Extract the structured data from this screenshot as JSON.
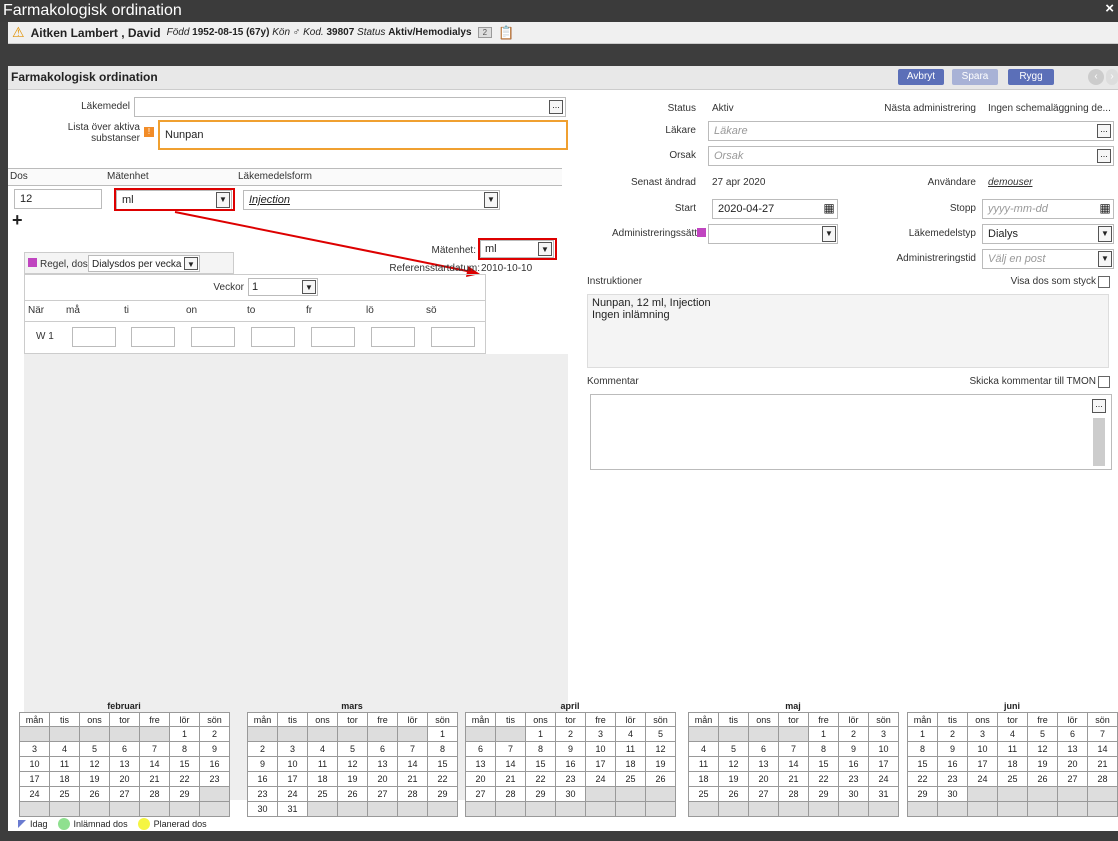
{
  "window": {
    "title": "Farmakologisk ordination",
    "close": "×"
  },
  "patient": {
    "name": "Aitken Lambert , David",
    "born_label": "Född",
    "born": "1952-08-15 (67y)",
    "sex_label": "Kön",
    "code_label": "Kod.",
    "code": "39807",
    "status_label": "Status",
    "status": "Aktiv/Hemodialys",
    "badge": "2"
  },
  "toolbar": {
    "title": "Farmakologisk ordination",
    "cancel": "Avbryt",
    "save": "Spara",
    "back": "Rygg",
    "colors": {
      "button": "#5b6fb8",
      "disabled": "#a8b2d6"
    }
  },
  "left": {
    "drug_label": "Läkemedel",
    "drug_value": "",
    "substances_label1": "Lista över aktiva",
    "substances_label2": "substanser",
    "substances_value": "Nunpan",
    "dose_header": "Dos",
    "unit_header": "Mätenhet",
    "form_header": "Läkemedelsform",
    "dose": "12",
    "unit": "ml",
    "form": "Injection",
    "add": "+",
    "rule_label": "Regel, dos",
    "rule_value": "Dialysdos per vecka",
    "unit2_label": "Mätenhet:",
    "unit2_value": "ml",
    "refdate_label": "Referensstartdatum:",
    "refdate": "2010-10-10",
    "weeks_label": "Veckor",
    "weeks_value": "1",
    "days": [
      "När",
      "må",
      "ti",
      "on",
      "to",
      "fr",
      "lö",
      "sö"
    ],
    "week_row": "W 1"
  },
  "right": {
    "status_label": "Status",
    "status": "Aktiv",
    "next_label": "Nästa administrering",
    "next": "Ingen schemaläggning de...",
    "doctor_label": "Läkare",
    "doctor_ph": "Läkare",
    "reason_label": "Orsak",
    "reason_ph": "Orsak",
    "changed_label": "Senast ändrad",
    "changed": "27 apr 2020",
    "user_label": "Användare",
    "user": "demouser",
    "start_label": "Start",
    "start": "2020-04-27",
    "stop_label": "Stopp",
    "stop_ph": "yyyy-mm-dd",
    "route_label": "Administreringssätt",
    "type_label": "Läkemedelstyp",
    "type": "Dialys",
    "time_label": "Administreringstid",
    "time_ph": "Välj en post",
    "instr_label": "Instruktioner",
    "show_label": "Visa dos som styck",
    "instr1": "Nunpan, 12 ml, Injection",
    "instr2": "Ingen inlämning",
    "comment_label": "Kommentar",
    "send_label": "Skicka kommentar till TMON"
  },
  "calendar": {
    "weekdays": [
      "mån",
      "tis",
      "ons",
      "tor",
      "fre",
      "lör",
      "sön"
    ],
    "months": [
      {
        "name": "februari",
        "rows": [
          [
            "",
            "",
            "",
            "",
            "",
            "1",
            "2"
          ],
          [
            "3",
            "4",
            "5",
            "6",
            "7",
            "8",
            "9"
          ],
          [
            "10",
            "11",
            "12",
            "13",
            "14",
            "15",
            "16"
          ],
          [
            "17",
            "18",
            "19",
            "20",
            "21",
            "22",
            "23"
          ],
          [
            "24",
            "25",
            "26",
            "27",
            "28",
            "29",
            ""
          ],
          [
            "",
            "",
            "",
            "",
            "",
            "",
            ""
          ]
        ]
      },
      {
        "name": "mars",
        "rows": [
          [
            "",
            "",
            "",
            "",
            "",
            "",
            "1"
          ],
          [
            "2",
            "3",
            "4",
            "5",
            "6",
            "7",
            "8"
          ],
          [
            "9",
            "10",
            "11",
            "12",
            "13",
            "14",
            "15"
          ],
          [
            "16",
            "17",
            "18",
            "19",
            "20",
            "21",
            "22"
          ],
          [
            "23",
            "24",
            "25",
            "26",
            "27",
            "28",
            "29"
          ],
          [
            "30",
            "31",
            "",
            "",
            "",
            "",
            ""
          ]
        ]
      },
      {
        "name": "april",
        "rows": [
          [
            "",
            "",
            "1",
            "2",
            "3",
            "4",
            "5"
          ],
          [
            "6",
            "7",
            "8",
            "9",
            "10",
            "11",
            "12"
          ],
          [
            "13",
            "14",
            "15",
            "16",
            "17",
            "18",
            "19"
          ],
          [
            "20",
            "21",
            "22",
            "23",
            "24",
            "25",
            "26"
          ],
          [
            "27",
            "28",
            "29",
            "30",
            "",
            "",
            ""
          ],
          [
            "",
            "",
            "",
            "",
            "",
            "",
            ""
          ]
        ]
      },
      {
        "name": "maj",
        "rows": [
          [
            "",
            "",
            "",
            "",
            "1",
            "2",
            "3"
          ],
          [
            "4",
            "5",
            "6",
            "7",
            "8",
            "9",
            "10"
          ],
          [
            "11",
            "12",
            "13",
            "14",
            "15",
            "16",
            "17"
          ],
          [
            "18",
            "19",
            "20",
            "21",
            "22",
            "23",
            "24"
          ],
          [
            "25",
            "26",
            "27",
            "28",
            "29",
            "30",
            "31"
          ],
          [
            "",
            "",
            "",
            "",
            "",
            "",
            ""
          ]
        ]
      },
      {
        "name": "juni",
        "rows": [
          [
            "1",
            "2",
            "3",
            "4",
            "5",
            "6",
            "7"
          ],
          [
            "8",
            "9",
            "10",
            "11",
            "12",
            "13",
            "14"
          ],
          [
            "15",
            "16",
            "17",
            "18",
            "19",
            "20",
            "21"
          ],
          [
            "22",
            "23",
            "24",
            "25",
            "26",
            "27",
            "28"
          ],
          [
            "29",
            "30",
            "",
            "",
            "",
            "",
            ""
          ],
          [
            "",
            "",
            "",
            "",
            "",
            "",
            ""
          ]
        ]
      }
    ],
    "legend": {
      "today": "Idag",
      "submitted": "Inlämnad dos",
      "planned": "Planerad dos",
      "colors": {
        "today": "#6a7bd0",
        "submitted": "#8fe08f",
        "planned": "#f5f542"
      }
    }
  }
}
